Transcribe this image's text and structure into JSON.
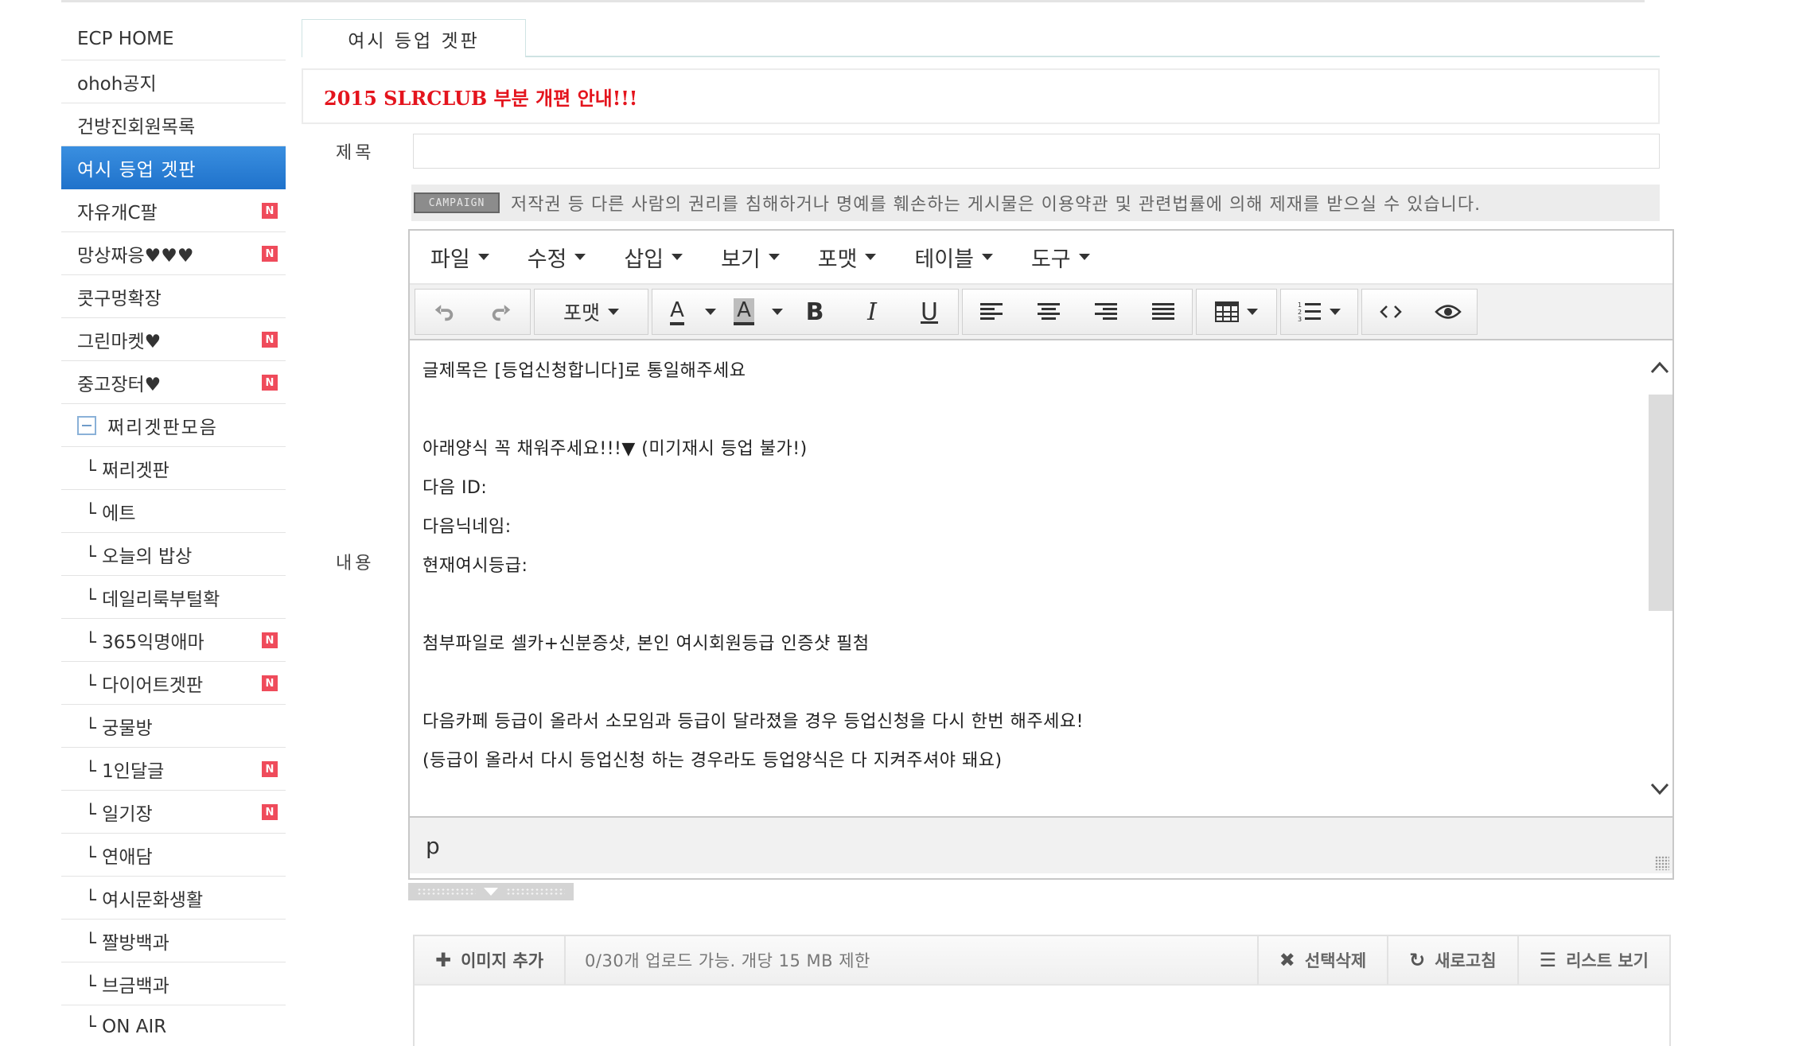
{
  "sidebar": {
    "items": [
      {
        "label": "ECP HOME",
        "badge": ""
      },
      {
        "label": "ohoh공지",
        "badge": ""
      },
      {
        "label": "건방진회원목록",
        "badge": ""
      },
      {
        "label": "여시 등업 겟판",
        "badge": ""
      },
      {
        "label": "자유개C팔",
        "badge": "N"
      },
      {
        "label": "망상짜응♥♥♥",
        "badge": "N"
      },
      {
        "label": "콧구멍확장",
        "badge": ""
      },
      {
        "label": "그린마켓♥",
        "badge": "N"
      },
      {
        "label": "중고장터♥",
        "badge": "N"
      }
    ],
    "folder": {
      "label": "쩌리겟판모음"
    },
    "subitems": [
      {
        "label": "└ 쩌리겟판",
        "badge": ""
      },
      {
        "label": "└ 에트",
        "badge": ""
      },
      {
        "label": "└ 오늘의 밥상",
        "badge": ""
      },
      {
        "label": "└ 데일리룩부털확",
        "badge": ""
      },
      {
        "label": "└ 365익명애마",
        "badge": "N"
      },
      {
        "label": "└ 다이어트겟판",
        "badge": "N"
      },
      {
        "label": "└ 궁물방",
        "badge": ""
      },
      {
        "label": "└ 1인달글",
        "badge": "N"
      },
      {
        "label": "└ 일기장",
        "badge": "N"
      },
      {
        "label": "└ 연애담",
        "badge": ""
      },
      {
        "label": "└ 여시문화생활",
        "badge": ""
      },
      {
        "label": "└ 짤방백과",
        "badge": ""
      },
      {
        "label": "└ 브금백과",
        "badge": ""
      },
      {
        "label": "└ ON AIR",
        "badge": ""
      }
    ]
  },
  "tab": {
    "label": "여시 등업 겟판"
  },
  "notice": {
    "text": "2015 SLRCLUB 부분 개편 안내!!!"
  },
  "form": {
    "title_label": "제목",
    "title_value": "",
    "content_label": "내용"
  },
  "campaign": {
    "logo": "CAMPAIGN",
    "text": "저작권 등 다른 사람의 권리를 침해하거나 명예를 훼손하는 게시물은 이용약관 및 관련법률에 의해 제재를 받으실 수 있습니다."
  },
  "editor": {
    "menu": [
      "파일",
      "수정",
      "삽입",
      "보기",
      "포맷",
      "테이블",
      "도구"
    ],
    "toolbar": {
      "undo": "undo-icon",
      "redo": "redo-icon",
      "format_label": "포맷",
      "font_color": "A",
      "bg_color": "A",
      "bold": "B",
      "italic": "I",
      "underline": "U"
    },
    "lines": [
      "글제목은 [등업신청합니다]로 통일해주세요",
      "",
      "아래양식 꼭 채워주세요!!!▼ (미기재시 등업 불가!)",
      "다음 ID:",
      "다음닉네임:",
      "현재여시등급:",
      "",
      "첨부파일로 셀카+신분증샷, 본인 여시회원등급 인증샷 필첨",
      "",
      "다음카페 등급이 올라서 소모임과 등급이 달라졌을 경우 등업신청을 다시 한번 해주세요!",
      "(등급이 올라서 다시 등업신청 하는 경우라도 등업양식은 다 지켜주셔야 돼요)"
    ],
    "status_path": "p"
  },
  "upload": {
    "add_label": "이미지 추가",
    "info": "0/30개 업로드 가능. 개당 15 MB 제한",
    "delete_label": "선택삭제",
    "refresh_label": "새로고침",
    "list_label": "리스트 보기"
  },
  "colors": {
    "accent": "#2a80d6",
    "badge": "#ef4b5b",
    "notice_red": "#e4141d"
  }
}
